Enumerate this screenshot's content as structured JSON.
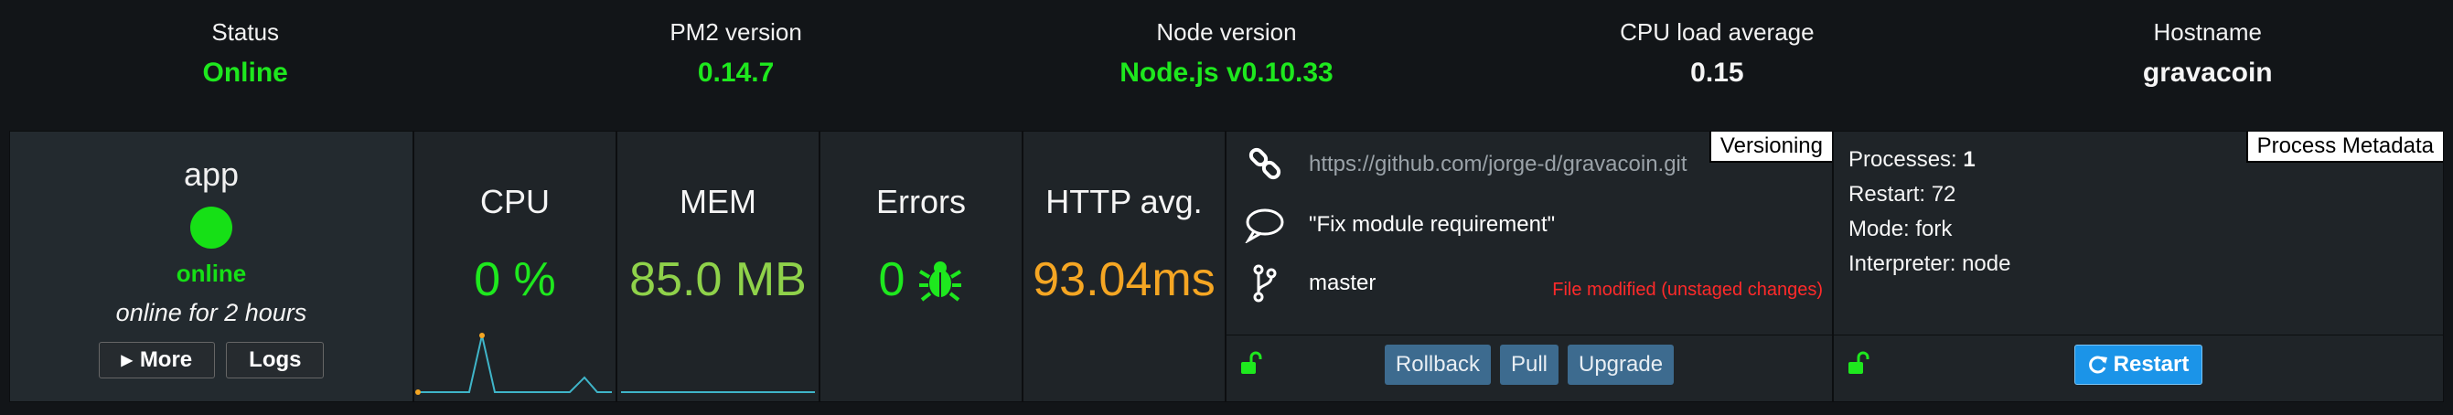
{
  "header": [
    {
      "label": "Status",
      "value": "Online",
      "color": "#1ee81e"
    },
    {
      "label": "PM2 version",
      "value": "0.14.7",
      "color": "#1ee81e"
    },
    {
      "label": "Node version",
      "value": "Node.js v0.10.33",
      "color": "#1ee81e"
    },
    {
      "label": "CPU load average",
      "value": "0.15",
      "color": "#f5f5f5"
    },
    {
      "label": "Hostname",
      "value": "gravacoin",
      "color": "#f5f5f5"
    }
  ],
  "app": {
    "name": "app",
    "status": "online",
    "uptime": "online for 2 hours",
    "more_label": "More",
    "logs_label": "Logs"
  },
  "metrics": {
    "cpu": {
      "label": "CPU",
      "value": "0 %"
    },
    "mem": {
      "label": "MEM",
      "value": "85.0 MB"
    },
    "errors": {
      "label": "Errors",
      "value": "0"
    },
    "http": {
      "label": "HTTP avg.",
      "value": "93.04ms"
    }
  },
  "versioning": {
    "tag": "Versioning",
    "repo_url": "https://github.com/jorge-d/gravacoin.git",
    "commit_message": "\"Fix module requirement\"",
    "branch": "master",
    "modified_notice": "File modified (unstaged changes)",
    "rollback_label": "Rollback",
    "pull_label": "Pull",
    "upgrade_label": "Upgrade"
  },
  "metadata": {
    "tag": "Process Metadata",
    "processes_label": "Processes:",
    "processes_value": "1",
    "restart_label": "Restart:",
    "restart_value": "72",
    "mode_label": "Mode:",
    "mode_value": "fork",
    "interpreter_label": "Interpreter:",
    "interpreter_value": "node",
    "restart_button": "Restart"
  },
  "icons": [
    "link-icon",
    "speech-bubble-icon",
    "branch-icon",
    "bug-icon",
    "unlock-icon",
    "refresh-icon",
    "caret-right-icon"
  ]
}
